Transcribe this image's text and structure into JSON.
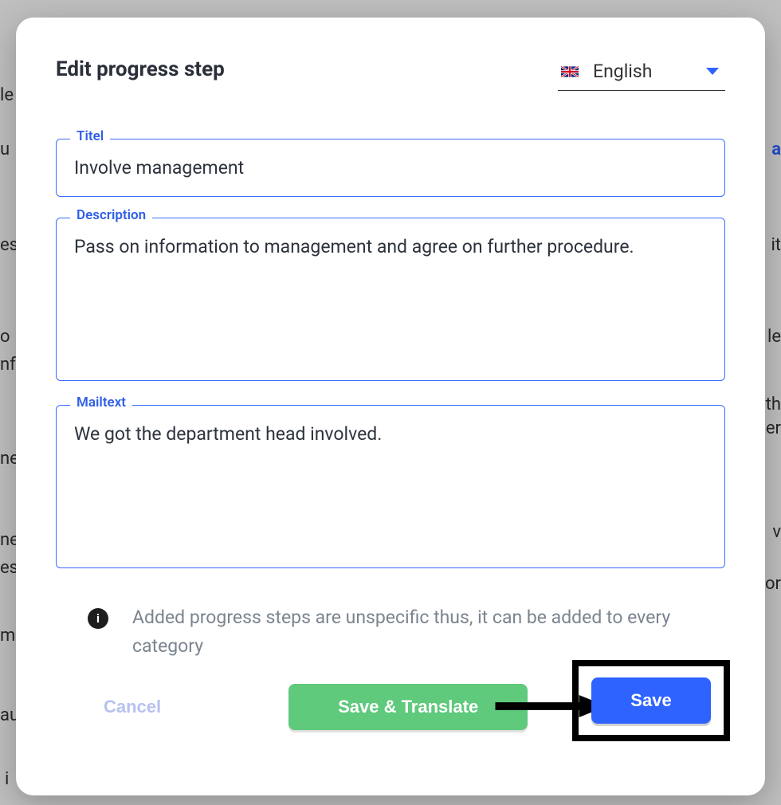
{
  "modal": {
    "title": "Edit progress step",
    "language": {
      "selected": "English",
      "flag": "uk"
    },
    "fields": {
      "titel": {
        "label": "Titel",
        "value": "Involve management"
      },
      "description": {
        "label": "Description",
        "value": "Pass on information to management and agree on further procedure."
      },
      "mailtext": {
        "label": "Mailtext",
        "value": "We got the department head involved."
      }
    },
    "info": "Added progress steps are unspecific thus, it can be added to every category",
    "buttons": {
      "cancel": "Cancel",
      "save_translate": "Save & Translate",
      "save": "Save"
    }
  },
  "background_fragments": [
    "le",
    "u",
    "es",
    "o",
    "nf",
    "ne",
    "ne",
    "es",
    "m",
    "au",
    "i",
    "a",
    "it",
    "le",
    "th",
    "er",
    "v",
    "or"
  ]
}
